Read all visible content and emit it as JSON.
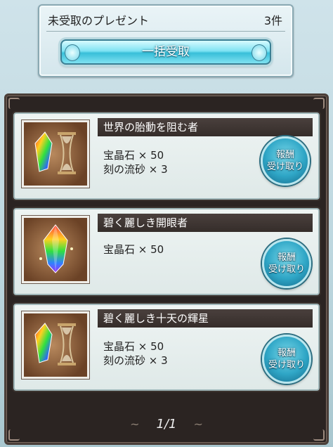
{
  "header": {
    "title": "未受取のプレゼント",
    "count": "3件",
    "bulk_button": "一括受取"
  },
  "presents": [
    {
      "title": "世界の胎動を阻む者",
      "rewards": [
        "宝晶石 × 50",
        "刻の流砂 × 3"
      ],
      "button_line1": "報酬",
      "button_line2": "受け取り",
      "icon": "crystal-and-hourglass-icon"
    },
    {
      "title": "碧く麗しき開眼者",
      "rewards": [
        "宝晶石 × 50"
      ],
      "button_line1": "報酬",
      "button_line2": "受け取り",
      "icon": "crystal-icon"
    },
    {
      "title": "碧く麗しき十天の輝星",
      "rewards": [
        "宝晶石 × 50",
        "刻の流砂 × 3"
      ],
      "button_line1": "報酬",
      "button_line2": "受け取り",
      "icon": "crystal-and-hourglass-icon"
    }
  ],
  "pager": {
    "label": "1/1",
    "left_arrow": "~",
    "right_arrow": "~"
  },
  "colors": {
    "accent": "#38bfd9",
    "frame": "#2b2422"
  }
}
